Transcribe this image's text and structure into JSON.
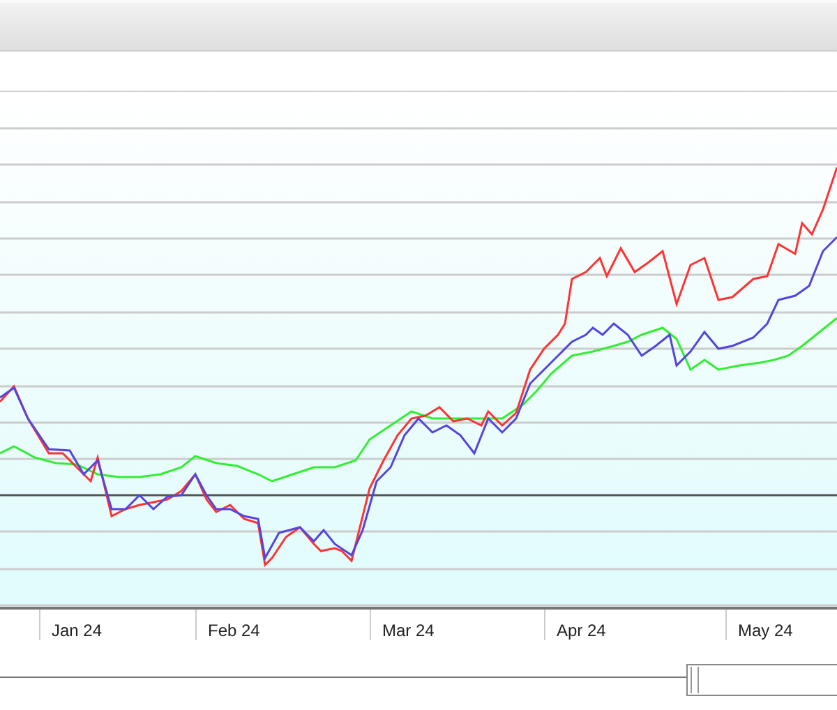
{
  "x_axis": {
    "labels": [
      "Jan 24",
      "Feb 24",
      "Mar 24",
      "Apr 24",
      "May 24"
    ]
  }
}
